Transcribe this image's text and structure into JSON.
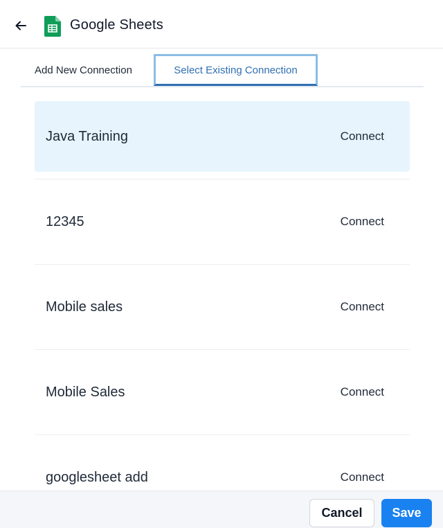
{
  "header": {
    "back_icon": "arrow-left-icon",
    "app_icon": "google-sheets-icon",
    "title": "Google Sheets"
  },
  "tabs": [
    {
      "label": "Add New Connection",
      "active": false
    },
    {
      "label": "Select Existing Connection",
      "active": true
    }
  ],
  "connections": [
    {
      "name": "Java Training",
      "action": "Connect",
      "selected": true
    },
    {
      "name": "12345",
      "action": "Connect",
      "selected": false
    },
    {
      "name": "Mobile sales",
      "action": "Connect",
      "selected": false
    },
    {
      "name": "Mobile Sales",
      "action": "Connect",
      "selected": false
    },
    {
      "name": "googlesheet add",
      "action": "Connect",
      "selected": false
    }
  ],
  "footer": {
    "cancel_label": "Cancel",
    "save_label": "Save"
  },
  "colors": {
    "accent": "#1a82f0",
    "selected_row": "#e7f4fd",
    "active_tab_text": "#2f6fb2",
    "sheets_green": "#0f9d58"
  }
}
